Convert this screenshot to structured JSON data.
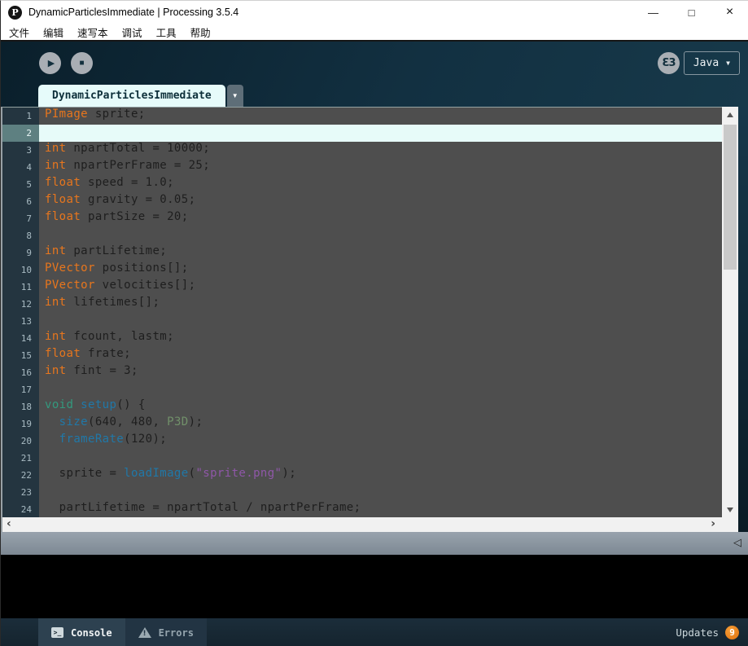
{
  "window": {
    "title": "DynamicParticlesImmediate | Processing 3.5.4",
    "controls": {
      "minimize": "—",
      "maximize": "□",
      "close": "×"
    }
  },
  "menubar": {
    "items": [
      "文件",
      "编辑",
      "速写本",
      "调试",
      "工具",
      "帮助"
    ]
  },
  "toolbar": {
    "mode_label": "Java"
  },
  "tabbar": {
    "tab_label": "DynamicParticlesImmediate"
  },
  "icons": {
    "logo": "P",
    "play": "▶",
    "stop": "■",
    "debug": "Ɛ3",
    "mode_arrow": "▼",
    "tab_dropdown": "▼",
    "hscroll_left": "‹",
    "hscroll_right": "›",
    "collapse_console": "◁",
    "console_prompt": ">_"
  },
  "editor": {
    "lines": [
      {
        "n": 1,
        "cur": false,
        "seg": [
          [
            "t",
            "PImage"
          ],
          [
            "p",
            " sprite;"
          ]
        ]
      },
      {
        "n": 2,
        "cur": true,
        "seg": []
      },
      {
        "n": 3,
        "cur": false,
        "seg": [
          [
            "t",
            "int"
          ],
          [
            "p",
            " npartTotal = 10000;"
          ]
        ]
      },
      {
        "n": 4,
        "cur": false,
        "seg": [
          [
            "t",
            "int"
          ],
          [
            "p",
            " npartPerFrame = 25;"
          ]
        ]
      },
      {
        "n": 5,
        "cur": false,
        "seg": [
          [
            "t",
            "float"
          ],
          [
            "p",
            " speed = 1.0;"
          ]
        ]
      },
      {
        "n": 6,
        "cur": false,
        "seg": [
          [
            "t",
            "float"
          ],
          [
            "p",
            " gravity = 0.05;"
          ]
        ]
      },
      {
        "n": 7,
        "cur": false,
        "seg": [
          [
            "t",
            "float"
          ],
          [
            "p",
            " partSize = 20;"
          ]
        ]
      },
      {
        "n": 8,
        "cur": false,
        "seg": []
      },
      {
        "n": 9,
        "cur": false,
        "seg": [
          [
            "t",
            "int"
          ],
          [
            "p",
            " partLifetime;"
          ]
        ]
      },
      {
        "n": 10,
        "cur": false,
        "seg": [
          [
            "t",
            "PVector"
          ],
          [
            "p",
            " positions[];"
          ]
        ]
      },
      {
        "n": 11,
        "cur": false,
        "seg": [
          [
            "t",
            "PVector"
          ],
          [
            "p",
            " velocities[];"
          ]
        ]
      },
      {
        "n": 12,
        "cur": false,
        "seg": [
          [
            "t",
            "int"
          ],
          [
            "p",
            " lifetimes[];"
          ]
        ]
      },
      {
        "n": 13,
        "cur": false,
        "seg": []
      },
      {
        "n": 14,
        "cur": false,
        "seg": [
          [
            "t",
            "int"
          ],
          [
            "p",
            " fcount, lastm;"
          ]
        ]
      },
      {
        "n": 15,
        "cur": false,
        "seg": [
          [
            "t",
            "float"
          ],
          [
            "p",
            " frate;"
          ]
        ]
      },
      {
        "n": 16,
        "cur": false,
        "seg": [
          [
            "t",
            "int"
          ],
          [
            "p",
            " fint = 3;"
          ]
        ]
      },
      {
        "n": 17,
        "cur": false,
        "seg": []
      },
      {
        "n": 18,
        "cur": false,
        "seg": [
          [
            "k",
            "void"
          ],
          [
            "p",
            " "
          ],
          [
            "f",
            "setup"
          ],
          [
            "p",
            "() {"
          ]
        ]
      },
      {
        "n": 19,
        "cur": false,
        "seg": [
          [
            "p",
            "  "
          ],
          [
            "f",
            "size"
          ],
          [
            "p",
            "(640, 480, "
          ],
          [
            "c",
            "P3D"
          ],
          [
            "p",
            ");"
          ]
        ]
      },
      {
        "n": 20,
        "cur": false,
        "seg": [
          [
            "p",
            "  "
          ],
          [
            "f",
            "frameRate"
          ],
          [
            "p",
            "(120);"
          ]
        ]
      },
      {
        "n": 21,
        "cur": false,
        "seg": []
      },
      {
        "n": 22,
        "cur": false,
        "seg": [
          [
            "p",
            "  sprite = "
          ],
          [
            "f",
            "loadImage"
          ],
          [
            "p",
            "("
          ],
          [
            "s",
            "\"sprite.png\""
          ],
          [
            "p",
            ");"
          ]
        ]
      },
      {
        "n": 23,
        "cur": false,
        "seg": []
      },
      {
        "n": 24,
        "cur": false,
        "seg": [
          [
            "p",
            "  partLifetime = npartTotal / npartPerFrame;"
          ]
        ]
      }
    ]
  },
  "footer": {
    "console_label": "Console",
    "errors_label": "Errors",
    "updates_label": "Updates",
    "updates_count": "9"
  },
  "colors": {
    "accent_orange": "#e8761d",
    "keyword_teal": "#33997e",
    "function_blue": "#2078a8",
    "constant_green": "#71906a",
    "string_purple": "#8f57a8",
    "editor_bg": "#4e4e4e",
    "gutter_bg": "#243540",
    "current_line_bg": "#e7fbf9",
    "header_navy": "#123041",
    "badge_orange": "#e2730e"
  }
}
